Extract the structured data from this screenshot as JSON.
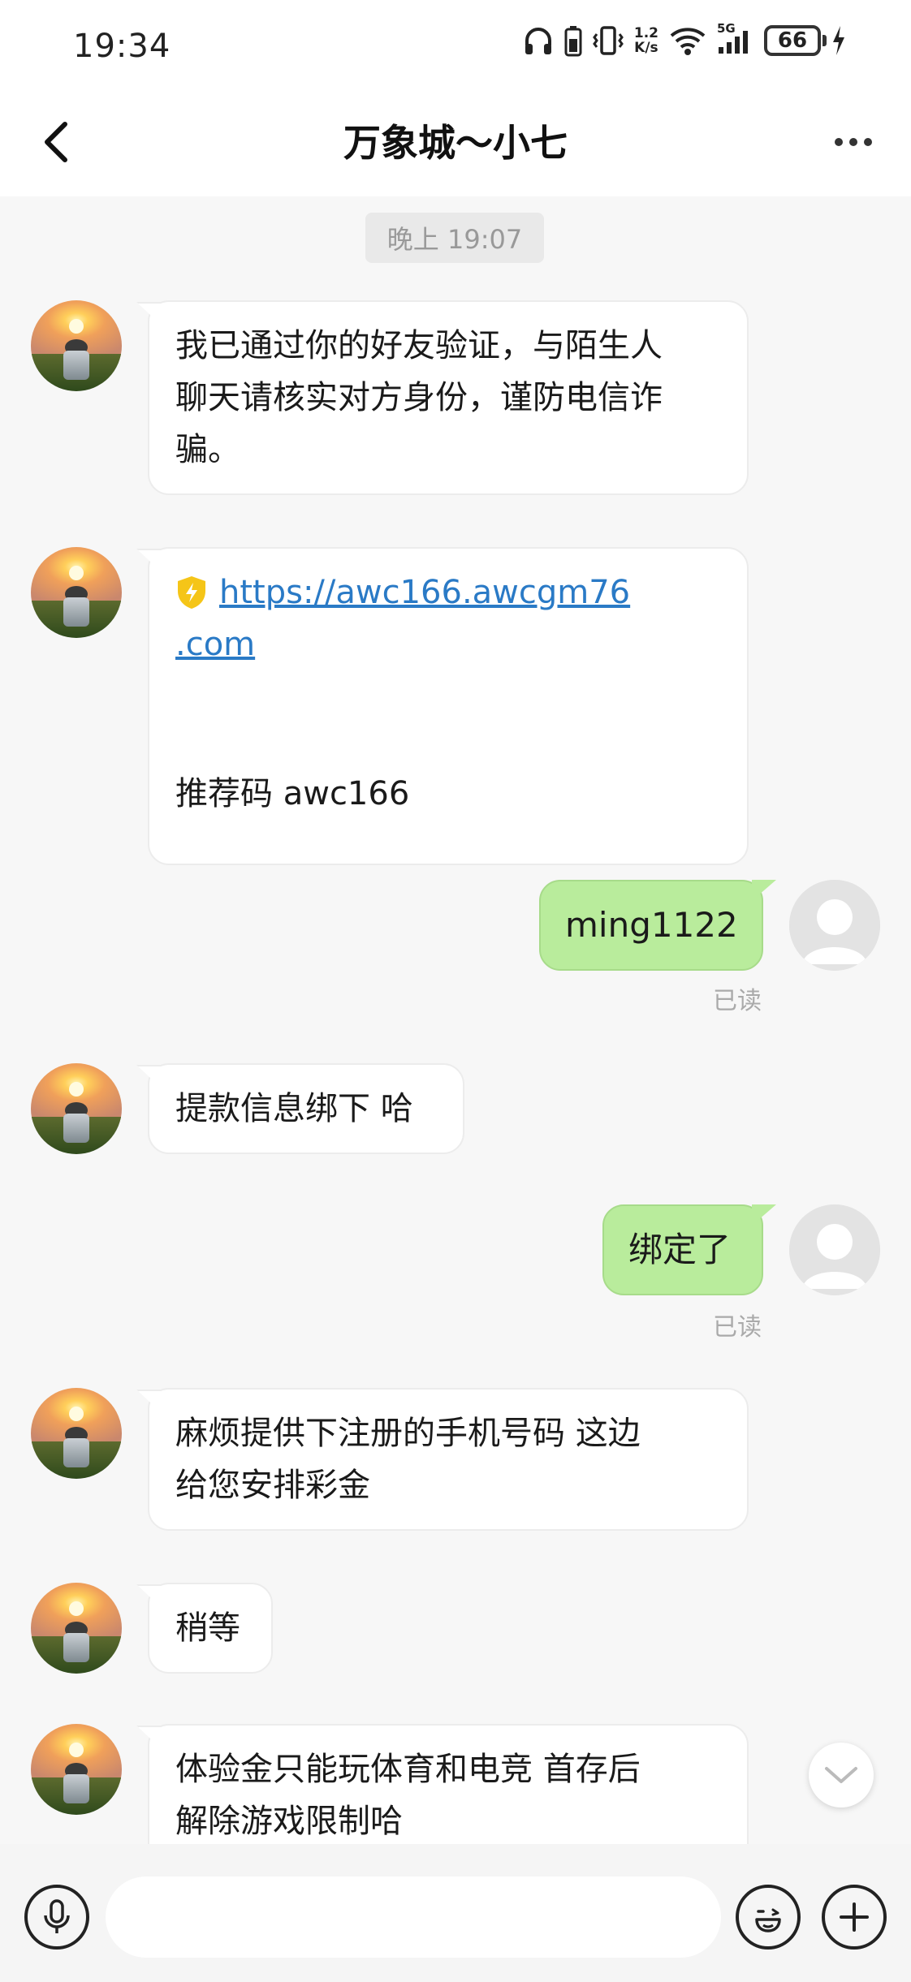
{
  "status_bar": {
    "time": "19:34",
    "net_speed_top": "1.2",
    "net_speed_bottom": "K/s",
    "network_type": "5G",
    "battery": "66"
  },
  "header": {
    "title": "万象城～小七",
    "back_icon": "chevron-left-icon",
    "more_icon": "more-horizontal-icon"
  },
  "chat": {
    "timestamp": "晚上 19:07",
    "messages": [
      {
        "side": "left",
        "lines": [
          "我已通过你的好友验证，与陌生人",
          "聊天请核实对方身份，谨防电信诈",
          "骗。"
        ]
      },
      {
        "side": "left",
        "link_lines": [
          "https://awc166.awcgm76",
          ".com"
        ],
        "extra_text": "推荐码  awc166"
      },
      {
        "side": "right",
        "text": "ming1122",
        "status": "已读"
      },
      {
        "side": "left",
        "text": "提款信息绑下 哈"
      },
      {
        "side": "right",
        "text": "绑定了",
        "status": "已读"
      },
      {
        "side": "left",
        "lines": [
          "麻烦提供下注册的手机号码 这边",
          "给您安排彩金"
        ]
      },
      {
        "side": "left",
        "text": "稍等"
      },
      {
        "side": "left",
        "lines": [
          "体验金只能玩体育和电竞 首存后",
          "解除游戏限制哈"
        ]
      }
    ]
  },
  "input_bar": {
    "placeholder": "",
    "icons": [
      "microphone-icon",
      "emoji-icon",
      "plus-icon"
    ]
  },
  "colors": {
    "accent_green": "#b9ec9c",
    "link_blue": "#2a7ac6",
    "shield_yellow": "#f5c518"
  }
}
